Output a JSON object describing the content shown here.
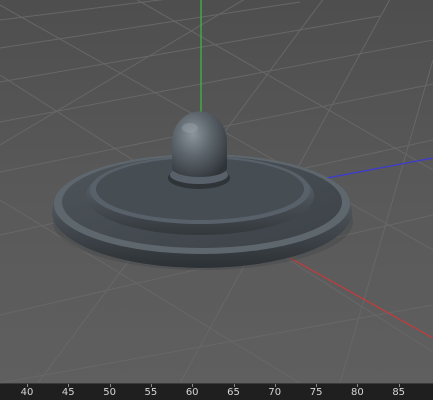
{
  "viewport": {
    "axes": {
      "y_axis_color": "#3cbf3c",
      "x_axis_color": "#c83a3a",
      "z_axis_color": "#3a3ad8"
    },
    "object": {
      "kind": "rounded disc base with knob",
      "color": "#565d63"
    },
    "background_color": "#5a5a5a",
    "grid_color": "#666666"
  },
  "timeline": {
    "ticks": [
      "40",
      "45",
      "50",
      "55",
      "60",
      "65",
      "70",
      "75",
      "80",
      "85"
    ],
    "background_color": "#1f1f1f"
  }
}
